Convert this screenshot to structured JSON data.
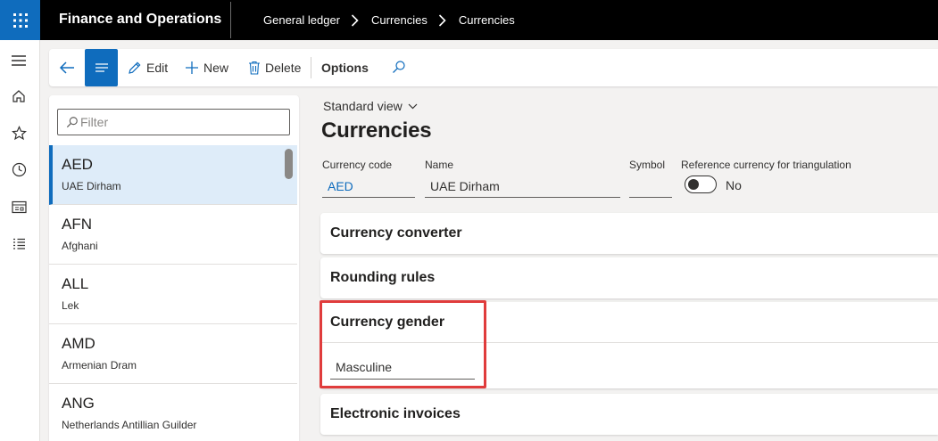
{
  "app": {
    "title": "Finance and Operations",
    "breadcrumb": [
      "General ledger",
      "Currencies",
      "Currencies"
    ]
  },
  "toolbar": {
    "edit_label": "Edit",
    "new_label": "New",
    "delete_label": "Delete",
    "options_label": "Options"
  },
  "list": {
    "filter_placeholder": "Filter",
    "items": [
      {
        "code": "AED",
        "name": "UAE Dirham",
        "selected": true
      },
      {
        "code": "AFN",
        "name": "Afghani"
      },
      {
        "code": "ALL",
        "name": "Lek"
      },
      {
        "code": "AMD",
        "name": "Armenian Dram"
      },
      {
        "code": "ANG",
        "name": "Netherlands Antillian Guilder"
      }
    ]
  },
  "main": {
    "view_label": "Standard view",
    "page_title": "Currencies",
    "fields": {
      "currency_code_label": "Currency code",
      "currency_code_value": "AED",
      "name_label": "Name",
      "name_value": "UAE Dirham",
      "symbol_label": "Symbol",
      "symbol_value": "",
      "reference_label": "Reference currency for triangulation",
      "reference_value": "No"
    },
    "sections": {
      "currency_converter": "Currency converter",
      "rounding_rules": "Rounding rules",
      "currency_gender": "Currency gender",
      "currency_gender_value": "Masculine",
      "electronic_invoices": "Electronic invoices"
    }
  },
  "colors": {
    "accent": "#0f6cbd",
    "selected_row": "#deecf9",
    "highlight": "#e03c3c",
    "topbar": "#000000"
  }
}
